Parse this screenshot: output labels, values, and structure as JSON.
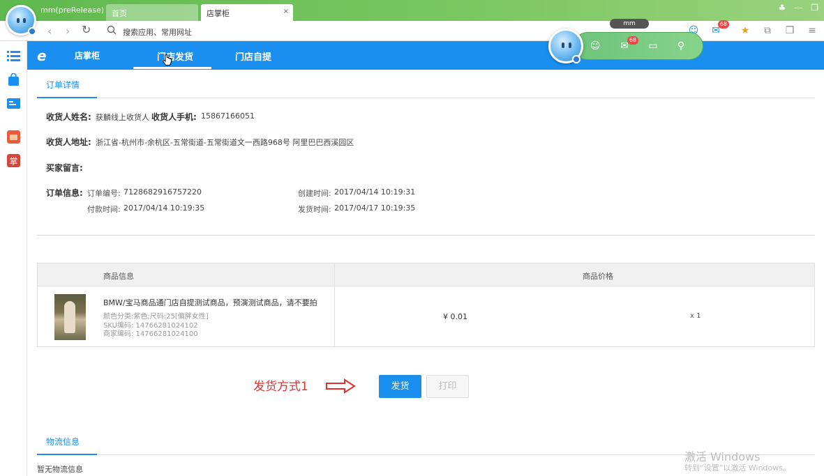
{
  "window": {
    "app_title": "mm(preRelease)",
    "tabs": [
      {
        "label": "首页"
      },
      {
        "label": "店掌柜",
        "close": "×"
      }
    ]
  },
  "addressbar": {
    "text": "搜索应用、常用网址"
  },
  "toolbar": {
    "mail_badge": "68"
  },
  "messenger": {
    "tag": "mm",
    "mail_badge": "68"
  },
  "header": {
    "logo": "e",
    "brand": "店掌柜",
    "nav": [
      {
        "label": "门店发货"
      },
      {
        "label": "门店自提"
      }
    ]
  },
  "order_section": {
    "tab": "订单详情",
    "receiver_name_label": "收货人姓名:",
    "receiver_name": "获麟线上收货人",
    "receiver_phone_label": "收货人手机:",
    "receiver_phone": "15867166051",
    "address_label": "收货人地址:",
    "address": "浙江省-杭州市-余杭区-五常街道-五常街道文一西路968号 阿里巴巴西溪园区",
    "buyer_msg_label": "买家留言:",
    "order_info_label": "订单信息:",
    "order_no_label": "订单编号:",
    "order_no": "7128682916757220",
    "created_label": "创建时间:",
    "created": "2017/04/14 10:19:31",
    "paid_label": "付款时间:",
    "paid": "2017/04/14 10:19:35",
    "shipped_label": "发货时间:",
    "shipped": "2017/04/17 10:19:35"
  },
  "product_table": {
    "col_info": "商品信息",
    "col_price": "商品价格",
    "title": "BMW/宝马商品通门店自提测试商品，预演测试商品，请不要拍",
    "attrs": "颜色分类:紫色;尺码:25[偏胖女性]",
    "sku": "SKU编码: 14766281024102",
    "merchant_code": "商家编码: 14766281024100",
    "price": "¥ 0.01",
    "quantity": "x 1"
  },
  "actions": {
    "annotation": "发货方式1",
    "ship": "发货",
    "print": "打印"
  },
  "logistics_section": {
    "tab": "物流信息",
    "empty": "暂无物流信息"
  },
  "watermark": {
    "line1": "激活 Windows",
    "line2": "转到“设置”以激活 Windows。"
  },
  "colors": {
    "brand_blue": "#1a8ff0",
    "titlebar_green": "#5fb94e",
    "annotation_red": "#e0302c"
  }
}
